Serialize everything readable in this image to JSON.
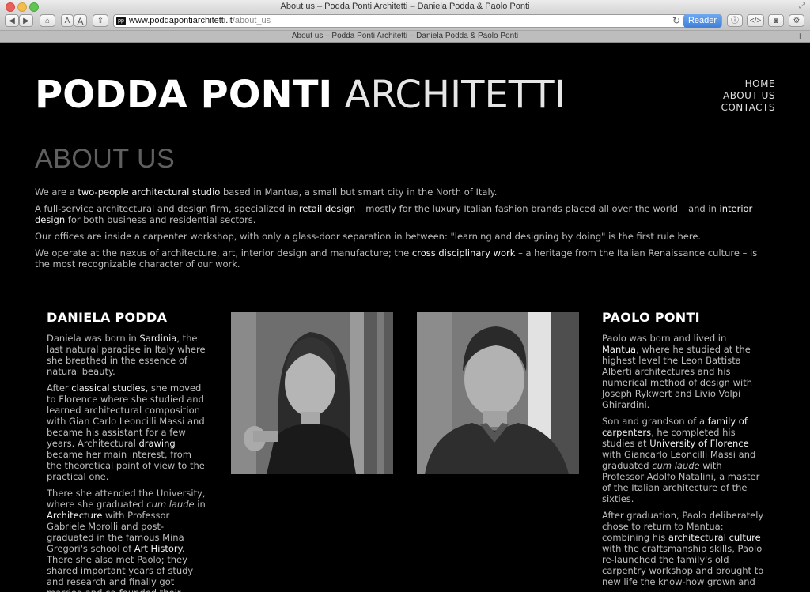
{
  "browser": {
    "window_title": "About us – Podda Ponti Architetti – Daniela Podda & Paolo Ponti",
    "tab_title": "About us – Podda Ponti Architetti – Daniela Podda & Paolo Ponti",
    "url_domain": "www.poddapontiarchitetti.it",
    "url_path": "/about_us",
    "favicon_text": "pp",
    "reader_label": "Reader",
    "font_small_label": "A",
    "font_large_label": "A"
  },
  "site": {
    "logo_bold": "PODDA PONTI",
    "logo_light": "ARCHITETTI",
    "nav": {
      "home": "HOME",
      "about": "ABOUT US",
      "contacts": "CONTACTS"
    },
    "heading": "ABOUT US"
  },
  "intro": {
    "p1_a": "We are a ",
    "p1_hl": "two-people architectural studio",
    "p1_b": " based in Mantua, a small but smart city in the North of Italy.",
    "p2_a": "A full-service architectural and design firm, specialized in ",
    "p2_hl1": "retail design",
    "p2_b": " – mostly for the luxury Italian fashion brands placed all over the world – and in ",
    "p2_hl2": "interior design",
    "p2_c": " for both business and residential sectors.",
    "p3": "Our offices are inside a carpenter workshop, with only a glass-door separation in between: \"learning and designing by doing\" is the first rule here.",
    "p4_a": "We operate at the nexus of architecture, art, interior design and manufacture; the ",
    "p4_hl": "cross disciplinary work",
    "p4_b": " – a heritage from the Italian Renaissance culture – is the most recognizable character of our work."
  },
  "daniela": {
    "name": "DANIELA PODDA",
    "p1_a": "Daniela was born in ",
    "p1_hl": "Sardinia",
    "p1_b": ", the last natural paradise in Italy where she breathed in the essence of natural beauty.",
    "p2_a": "After ",
    "p2_hl1": "classical studies",
    "p2_b": ", she moved to Florence where she studied and learned architectural composition with Gian Carlo Leoncilli Massi and became his assistant for a few years. Architectural ",
    "p2_hl2": "drawing",
    "p2_c": " became her main interest, from the theoretical point of view to the practical one.",
    "p3_a": "There she attended the University, where she graduated ",
    "p3_em": "cum laude",
    "p3_b": " in ",
    "p3_hl1": "Architecture",
    "p3_c": " with Professor Gabriele Morolli and post-graduated in the famous Mina Gregori's school of ",
    "p3_hl2": "Art History",
    "p3_d": ". There she also met Paolo; they shared important years of study and research and finally got married and co-founded their"
  },
  "paolo": {
    "name": "PAOLO PONTI",
    "p1_a": "Paolo was born and lived in ",
    "p1_hl": "Mantua",
    "p1_b": ", where he studied at the highest level the Leon Battista Alberti architectures and his numerical method of design with Joseph Rykwert and Livio Volpi Ghirardini.",
    "p2_a": "Son and grandson of a ",
    "p2_hl1": "family of carpenters",
    "p2_b": ", he completed his studies at ",
    "p2_hl2": "University of Florence",
    "p2_c": " with Giancarlo Leoncilli Massi and graduated ",
    "p2_em": "cum laude",
    "p2_d": " with Professor Adolfo Natalini, a master of the Italian architecture of the sixties.",
    "p3_a": "After graduation, Paolo deliberately chose to return to Mantua: combining his ",
    "p3_hl": "architectural culture",
    "p3_b": " with the craftsmanship skills, Paolo re-launched the family's old carpentry workshop and brought to new life the know-how grown and"
  }
}
